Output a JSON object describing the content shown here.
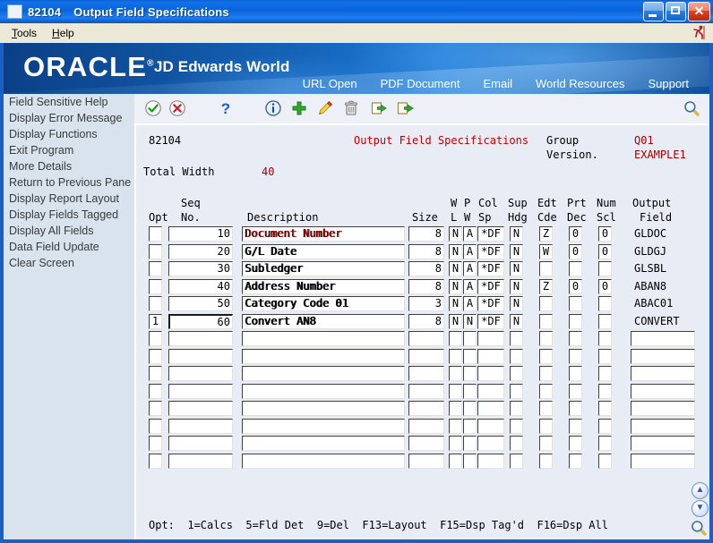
{
  "window": {
    "id": "82104",
    "title": "Output Field Specifications",
    "buttons": {
      "minimize": "_",
      "maximize": "□",
      "close": "✕"
    }
  },
  "menubar": {
    "items": [
      {
        "label": "Tools",
        "accel": "T"
      },
      {
        "label": "Help",
        "accel": "H"
      }
    ],
    "exit_icon": "exit-runner-icon"
  },
  "banner": {
    "logo": "ORACLE",
    "logo_mark": "®",
    "product": "JD Edwards World",
    "nav": [
      {
        "label": "URL Open"
      },
      {
        "label": "PDF Document"
      },
      {
        "label": "Email"
      },
      {
        "label": "World Resources"
      },
      {
        "label": "Support"
      }
    ]
  },
  "toolbar": {
    "items": [
      {
        "name": "ok-check-icon",
        "title": "OK"
      },
      {
        "name": "cancel-x-icon",
        "title": "Cancel"
      },
      {
        "name": "help-question-icon",
        "title": "Help"
      },
      {
        "name": "info-icon",
        "title": "Information"
      },
      {
        "name": "add-plus-icon",
        "title": "Add"
      },
      {
        "name": "edit-pencil-icon",
        "title": "Edit"
      },
      {
        "name": "delete-trash-icon",
        "title": "Delete"
      },
      {
        "name": "previous-panel-icon",
        "title": "Previous"
      },
      {
        "name": "exit-panel-icon",
        "title": "Exit"
      },
      {
        "name": "search-magnifier-icon",
        "title": "Search"
      }
    ]
  },
  "sidebar": {
    "items": [
      {
        "label": "Field Sensitive Help"
      },
      {
        "label": "Display Error Message"
      },
      {
        "label": "Display Functions"
      },
      {
        "label": "Exit Program"
      },
      {
        "label": "More Details"
      },
      {
        "label": "Return to Previous Pane"
      },
      {
        "label": "Display Report Layout"
      },
      {
        "label": "Display Fields Tagged"
      },
      {
        "label": "Display All Fields"
      },
      {
        "label": "Data Field Update"
      },
      {
        "label": "Clear Screen"
      }
    ]
  },
  "form": {
    "program_id": "82104",
    "title": "Output Field Specifications",
    "group_label": "Group",
    "group_value": "Q01",
    "version_label": "Version.",
    "version_value": "EXAMPLE1",
    "total_width_label": "Total Width",
    "total_width_value": "40",
    "columns": {
      "opt": "Opt",
      "seq_top": "Seq",
      "seq_bottom": "No.",
      "description": "Description",
      "size": "Size",
      "wl_top": "W",
      "wl_bottom": "L",
      "pw_top": "P",
      "pw_bottom": "W",
      "colsp_top": "Col",
      "colsp_bottom": "Sp",
      "suphdg_top": "Sup",
      "suphdg_bottom": "Hdg",
      "edtcde_top": "Edt",
      "edtcde_bottom": "Cde",
      "prtdec_top": "Prt",
      "prtdec_bottom": "Dec",
      "numscl_top": "Num",
      "numscl_bottom": "Scl",
      "output_top": "Output",
      "output_bottom": "Field"
    },
    "rows": [
      {
        "opt": "",
        "seq": "10",
        "description": "Document Number",
        "desc_red": true,
        "size": "8",
        "wl": "N",
        "pw": "A",
        "colsp": "*DF",
        "suphdg": "N",
        "edtcde": "Z",
        "prtdec": "0",
        "numscl": "0",
        "output": "GLDOC",
        "focus": false
      },
      {
        "opt": "",
        "seq": "20",
        "description": "G/L Date",
        "desc_red": false,
        "size": "8",
        "wl": "N",
        "pw": "A",
        "colsp": "*DF",
        "suphdg": "N",
        "edtcde": "W",
        "prtdec": "0",
        "numscl": "0",
        "output": "GLDGJ",
        "focus": false
      },
      {
        "opt": "",
        "seq": "30",
        "description": "Subledger",
        "desc_red": false,
        "size": "8",
        "wl": "N",
        "pw": "A",
        "colsp": "*DF",
        "suphdg": "N",
        "edtcde": "",
        "prtdec": "",
        "numscl": "",
        "output": "GLSBL",
        "focus": false
      },
      {
        "opt": "",
        "seq": "40",
        "description": "Address Number",
        "desc_red": false,
        "size": "8",
        "wl": "N",
        "pw": "A",
        "colsp": "*DF",
        "suphdg": "N",
        "edtcde": "Z",
        "prtdec": "0",
        "numscl": "0",
        "output": "ABAN8",
        "focus": false
      },
      {
        "opt": "",
        "seq": "50",
        "description": "Category Code 01",
        "desc_red": false,
        "size": "3",
        "wl": "N",
        "pw": "A",
        "colsp": "*DF",
        "suphdg": "N",
        "edtcde": "",
        "prtdec": "",
        "numscl": "",
        "output": "ABAC01",
        "focus": false
      },
      {
        "opt": "1",
        "seq": "60",
        "description": "Convert AN8",
        "desc_red": false,
        "size": "8",
        "wl": "N",
        "pw": "N",
        "colsp": "*DF",
        "suphdg": "N",
        "edtcde": "",
        "prtdec": "",
        "numscl": "",
        "output": "CONVERT",
        "focus": true
      },
      {
        "opt": "",
        "seq": "",
        "description": "",
        "desc_red": false,
        "size": "",
        "wl": "",
        "pw": "",
        "colsp": "",
        "suphdg": "",
        "edtcde": "",
        "prtdec": "",
        "numscl": "",
        "output": "",
        "focus": false
      },
      {
        "opt": "",
        "seq": "",
        "description": "",
        "desc_red": false,
        "size": "",
        "wl": "",
        "pw": "",
        "colsp": "",
        "suphdg": "",
        "edtcde": "",
        "prtdec": "",
        "numscl": "",
        "output": "",
        "focus": false
      },
      {
        "opt": "",
        "seq": "",
        "description": "",
        "desc_red": false,
        "size": "",
        "wl": "",
        "pw": "",
        "colsp": "",
        "suphdg": "",
        "edtcde": "",
        "prtdec": "",
        "numscl": "",
        "output": "",
        "focus": false
      },
      {
        "opt": "",
        "seq": "",
        "description": "",
        "desc_red": false,
        "size": "",
        "wl": "",
        "pw": "",
        "colsp": "",
        "suphdg": "",
        "edtcde": "",
        "prtdec": "",
        "numscl": "",
        "output": "",
        "focus": false
      },
      {
        "opt": "",
        "seq": "",
        "description": "",
        "desc_red": false,
        "size": "",
        "wl": "",
        "pw": "",
        "colsp": "",
        "suphdg": "",
        "edtcde": "",
        "prtdec": "",
        "numscl": "",
        "output": "",
        "focus": false
      },
      {
        "opt": "",
        "seq": "",
        "description": "",
        "desc_red": false,
        "size": "",
        "wl": "",
        "pw": "",
        "colsp": "",
        "suphdg": "",
        "edtcde": "",
        "prtdec": "",
        "numscl": "",
        "output": "",
        "focus": false
      },
      {
        "opt": "",
        "seq": "",
        "description": "",
        "desc_red": false,
        "size": "",
        "wl": "",
        "pw": "",
        "colsp": "",
        "suphdg": "",
        "edtcde": "",
        "prtdec": "",
        "numscl": "",
        "output": "",
        "focus": false
      },
      {
        "opt": "",
        "seq": "",
        "description": "",
        "desc_red": false,
        "size": "",
        "wl": "",
        "pw": "",
        "colsp": "",
        "suphdg": "",
        "edtcde": "",
        "prtdec": "",
        "numscl": "",
        "output": "",
        "focus": false
      }
    ],
    "footer": "Opt:  1=Calcs  5=Fld Det  9=Del  F13=Layout  F15=Dsp Tag'd  F16=Dsp All"
  },
  "scrollbuttons": {
    "up": "▲",
    "down": "▼",
    "search": "search-magnifier-icon"
  },
  "colors": {
    "title_red": "#c00000",
    "value_red": "#a00000",
    "banner_blue": "#10529f",
    "panel_bg": "#e8ecf5",
    "sidebar_bg": "#d9e3ee",
    "window_border": "#1a5fc8"
  }
}
